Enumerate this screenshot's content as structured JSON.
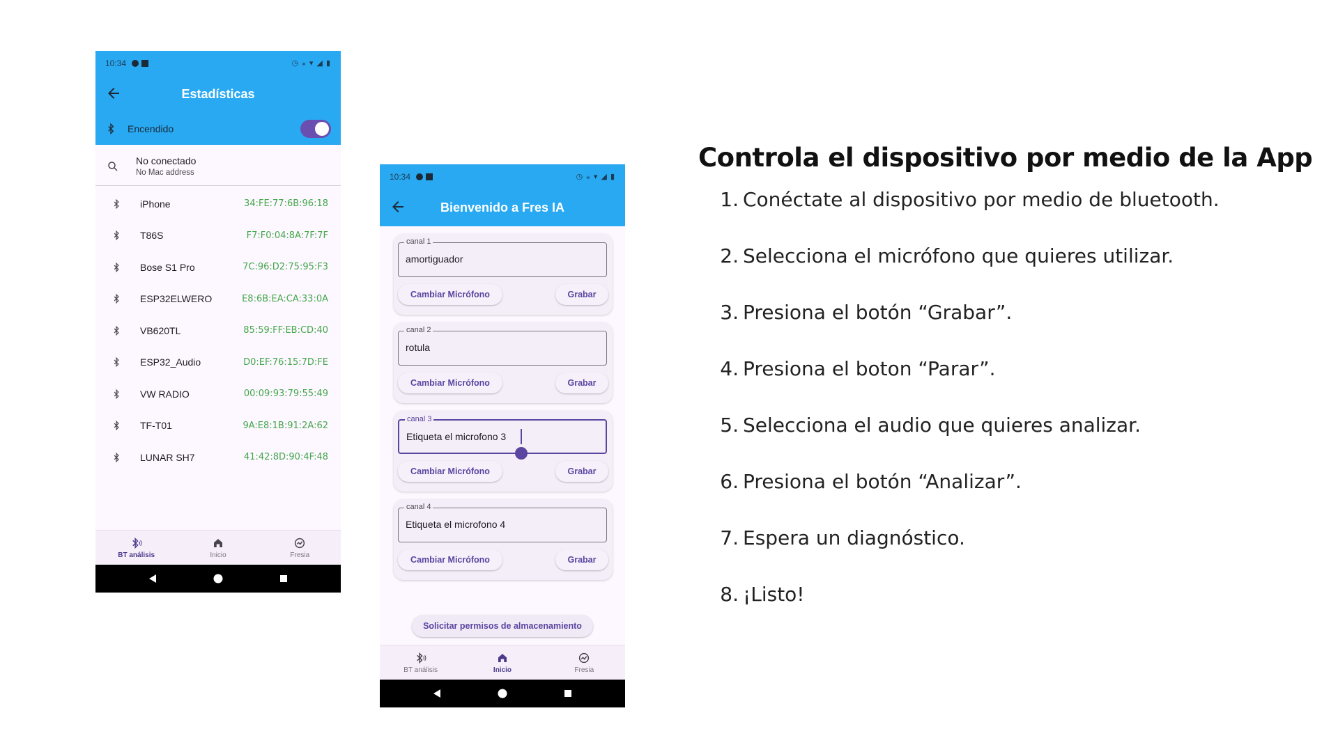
{
  "phone1": {
    "status_time": "10:34",
    "title": "Estadísticas",
    "bluetooth_label": "Encendido",
    "bluetooth_on": true,
    "connection": {
      "status": "No conectado",
      "mac": "No Mac address"
    },
    "devices": [
      {
        "name": "iPhone",
        "mac": "34:FE:77:6B:96:18"
      },
      {
        "name": "T86S",
        "mac": "F7:F0:04:8A:7F:7F"
      },
      {
        "name": "Bose S1 Pro",
        "mac": "7C:96:D2:75:95:F3"
      },
      {
        "name": "ESP32ELWERO",
        "mac": "E8:6B:EA:CA:33:0A"
      },
      {
        "name": "VB620TL",
        "mac": "85:59:FF:EB:CD:40"
      },
      {
        "name": "ESP32_Audio",
        "mac": "D0:EF:76:15:7D:FE"
      },
      {
        "name": "VW RADIO",
        "mac": "00:09:93:79:55:49"
      },
      {
        "name": "TF-T01",
        "mac": "9A:E8:1B:91:2A:62"
      },
      {
        "name": "LUNAR SH7",
        "mac": "41:42:8D:90:4F:48"
      }
    ],
    "nav": [
      {
        "label": "BT análisis",
        "icon": "bluetooth-audio-icon",
        "active": true
      },
      {
        "label": "Inicio",
        "icon": "home-icon",
        "active": false
      },
      {
        "label": "Fresia",
        "icon": "analytics-icon",
        "active": false
      }
    ]
  },
  "phone2": {
    "status_time": "10:34",
    "title": "Bienvenido a Fres IA",
    "channels": [
      {
        "label": "canal 1",
        "value": "amortiguador",
        "change": "Cambiar Micrófono",
        "record": "Grabar"
      },
      {
        "label": "canal 2",
        "value": "rotula",
        "change": "Cambiar Micrófono",
        "record": "Grabar"
      },
      {
        "label": "canal 3",
        "value": "Etiqueta el microfono 3",
        "change": "Cambiar Micrófono",
        "record": "Grabar"
      },
      {
        "label": "canal 4",
        "value": "Etiqueta el microfono 4",
        "change": "Cambiar Micrófono",
        "record": "Grabar"
      }
    ],
    "permissions_button": "Solicitar permisos de almacenamiento",
    "nav": [
      {
        "label": "BT análisis",
        "icon": "bluetooth-audio-icon",
        "active": false
      },
      {
        "label": "Inicio",
        "icon": "home-icon",
        "active": true
      },
      {
        "label": "Fresia",
        "icon": "analytics-icon",
        "active": false
      }
    ]
  },
  "instructions": {
    "title": "Controla el dispositivo por medio de la App",
    "steps": [
      {
        "num": "1.",
        "text": "Conéctate al dispositivo por medio de bluetooth."
      },
      {
        "num": "2.",
        "text": "Selecciona el micrófono que quieres utilizar."
      },
      {
        "num": "3.",
        "text": "Presiona el botón “Grabar”."
      },
      {
        "num": "4.",
        "text": "Presiona el boton “Parar”."
      },
      {
        "num": "5.",
        "text": "Selecciona el audio que quieres analizar."
      },
      {
        "num": "6.",
        "text": "Presiona el botón “Analizar”."
      },
      {
        "num": "7.",
        "text": "Espera un diagnóstico."
      },
      {
        "num": "8.",
        "text": "¡Listo!"
      }
    ]
  },
  "colors": {
    "appbar": "#29a9f2",
    "accent": "#5a46a0",
    "mac_green": "#43a84a"
  }
}
